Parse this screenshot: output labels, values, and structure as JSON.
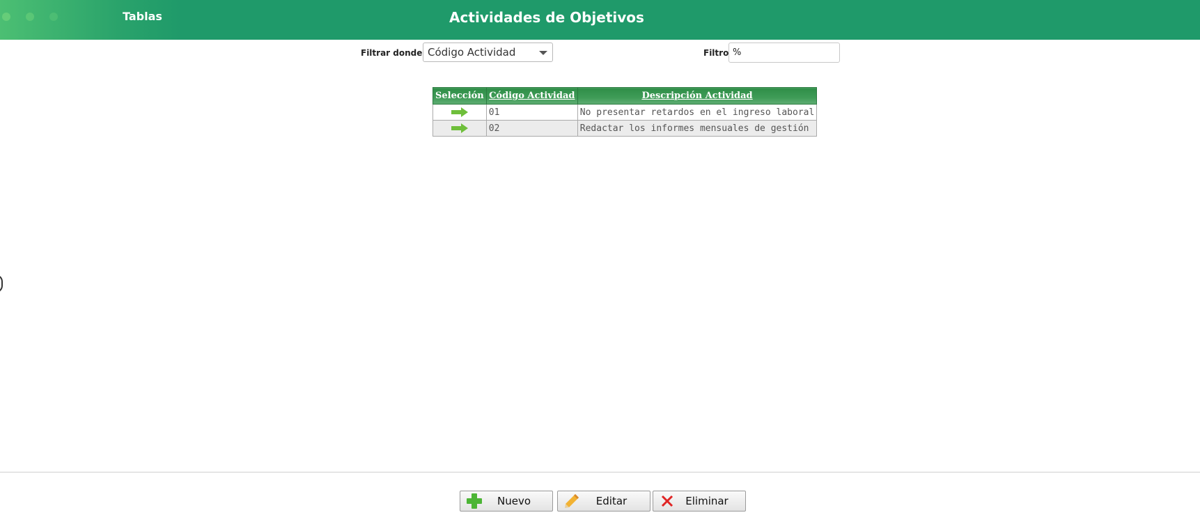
{
  "header": {
    "tab_label": "Tablas",
    "title": "Actividades de Objetivos"
  },
  "filter": {
    "label": "Filtrar donde",
    "selected": "Código Actividad",
    "filtro_label": "Filtro",
    "filtro_value": "%"
  },
  "table": {
    "columns": [
      "Selección",
      "Código Actividad",
      "Descripción Actividad"
    ],
    "rows": [
      {
        "code": "01",
        "description": "No presentar retardos en el ingreso laboral"
      },
      {
        "code": "02",
        "description": "Redactar los informes mensuales de gestión"
      }
    ]
  },
  "buttons": {
    "nuevo": "Nuevo",
    "editar": "Editar",
    "eliminar": "Eliminar"
  },
  "icons": {
    "select_row": "arrow-right-icon",
    "nuevo": "plus-icon",
    "editar": "pencil-icon",
    "eliminar": "x-icon"
  },
  "colors": {
    "header": "#1f9a6a",
    "table_header": "#3f9c57",
    "arrow": "#6fbf3b"
  }
}
